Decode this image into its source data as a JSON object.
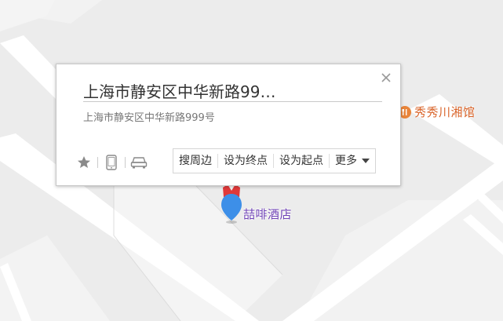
{
  "map": {
    "background_color": "#ececec",
    "road_color": "#ffffff"
  },
  "poi": {
    "restaurant_label": "秀秀川湘馆",
    "restaurant_icon": "restaurant-fork-icon",
    "restaurant_color": "#d9642a",
    "hotel_label": "喆啡酒店",
    "hotel_color": "#6f42b5"
  },
  "marker": {
    "icon": "map-pin-icon",
    "pin_color": "#3d8fe8",
    "top_color": "#e0393a"
  },
  "info_window": {
    "title": "上海市静安区中华新路99…",
    "address": "上海市静安区中华新路999号",
    "close_icon": "close-icon",
    "tools": [
      {
        "icon": "star-icon"
      },
      {
        "icon": "phone-icon"
      },
      {
        "icon": "car-icon"
      }
    ],
    "actions": {
      "search_nearby": "搜周边",
      "set_end": "设为终点",
      "set_start": "设为起点",
      "more": "更多"
    }
  }
}
